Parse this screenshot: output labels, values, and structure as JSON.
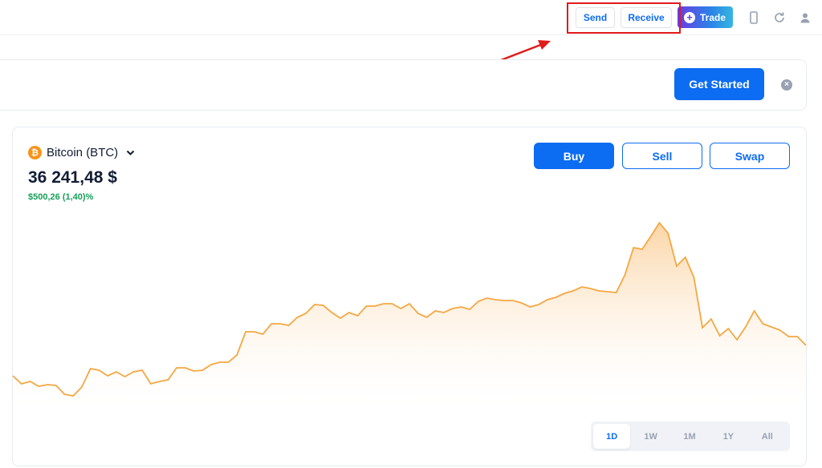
{
  "header": {
    "send_label": "Send",
    "receive_label": "Receive",
    "trade_label": "Trade",
    "icons": [
      "phone-icon",
      "refresh-icon",
      "user-icon"
    ]
  },
  "banner": {
    "cta_label": "Get Started",
    "close_icon": "close-icon"
  },
  "asset": {
    "symbol_glyph": "₿",
    "name": "Bitcoin (BTC)",
    "price": "36 241,48 $",
    "change": "$500,26 (1,40)%"
  },
  "actions": {
    "buy_label": "Buy",
    "sell_label": "Sell",
    "swap_label": "Swap"
  },
  "chart_data": {
    "type": "area",
    "title": "",
    "series": [
      {
        "values": [
          469,
          479,
          476,
          482,
          480,
          481,
          492,
          494,
          483,
          460,
          462,
          469,
          464,
          470,
          464,
          462,
          479,
          476,
          474,
          459,
          459,
          463,
          462,
          455,
          452,
          452,
          443,
          414,
          414,
          417,
          404,
          404,
          406,
          396,
          391,
          380,
          381,
          390,
          397,
          390,
          394,
          382,
          382,
          379,
          379,
          385,
          379,
          391,
          396,
          388,
          390,
          385,
          383,
          386,
          376,
          372,
          374,
          375,
          375,
          378,
          383,
          380,
          374,
          371,
          366,
          363,
          358,
          360,
          363,
          364,
          365,
          343,
          309,
          311,
          295,
          278,
          291,
          332,
          321,
          346,
          409,
          398,
          419,
          410,
          424,
          408,
          388,
          404,
          408,
          412,
          420,
          420,
          431
        ]
      }
    ],
    "color": "#f5a742",
    "grid": false
  },
  "ranges": {
    "tabs": [
      "1D",
      "1W",
      "1M",
      "1Y",
      "All"
    ],
    "active": "1D"
  },
  "colors": {
    "primary": "#0c6cf2",
    "positive": "#17a058",
    "annotation": "#e01b1b"
  }
}
